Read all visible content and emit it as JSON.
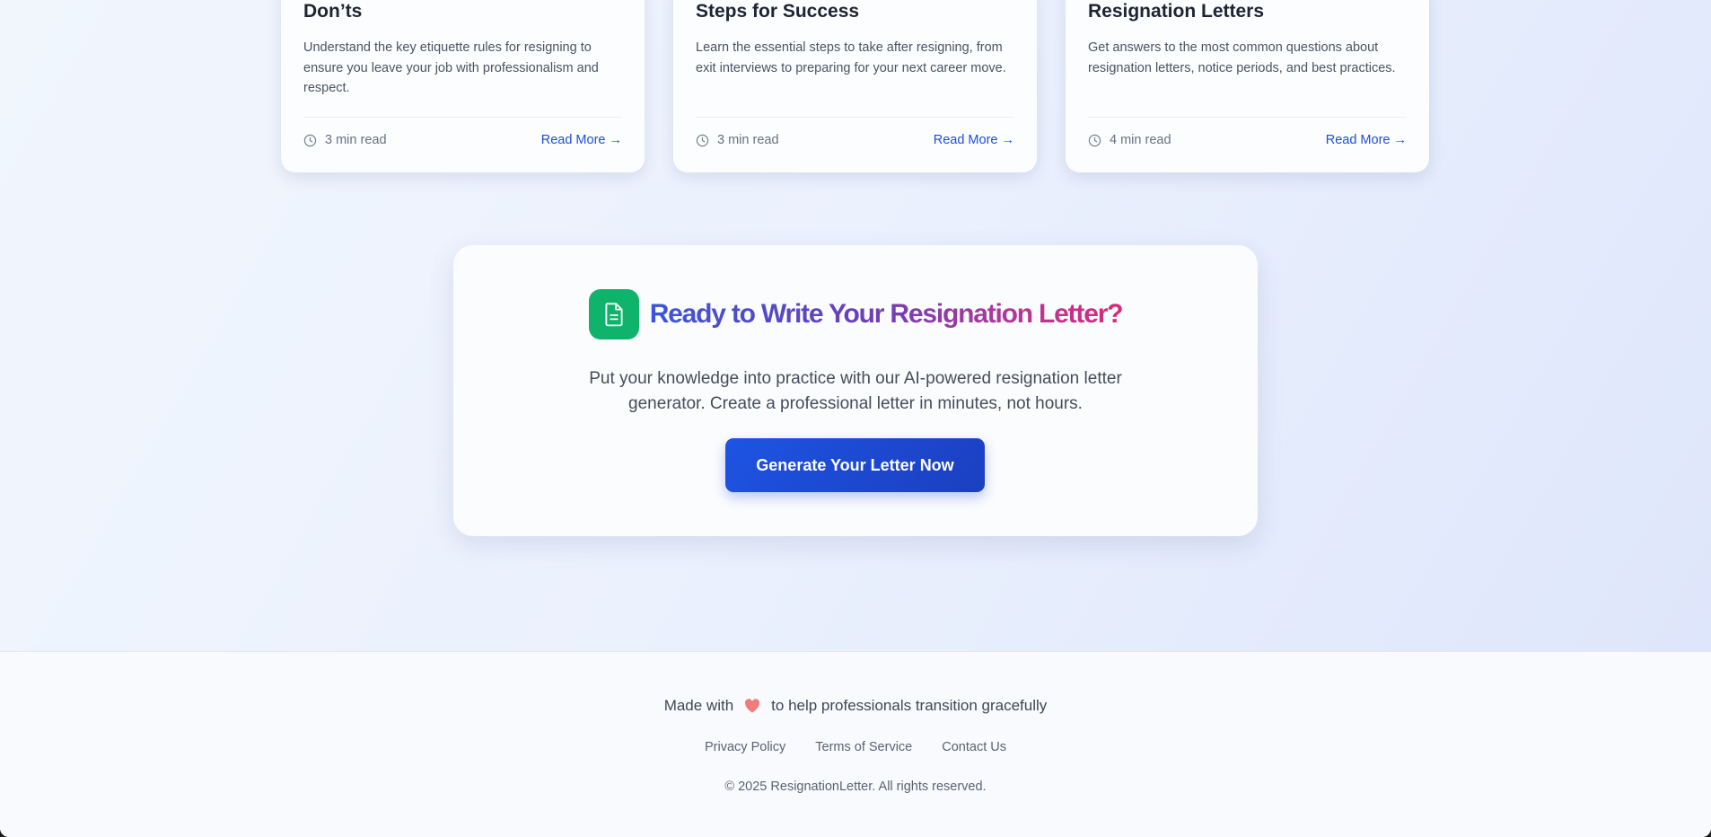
{
  "articles": [
    {
      "title": "Don’ts",
      "description": "Understand the key etiquette rules for resigning to ensure you leave your job with professionalism and respect.",
      "read_time": "3 min read",
      "link_label": "Read More →"
    },
    {
      "title": "Steps for Success",
      "description": "Learn the essential steps to take after resigning, from exit interviews to preparing for your next career move.",
      "read_time": "3 min read",
      "link_label": "Read More →"
    },
    {
      "title": "Resignation Letters",
      "description": "Get answers to the most common questions about resignation letters, notice periods, and best practices.",
      "read_time": "4 min read",
      "link_label": "Read More →"
    }
  ],
  "cta": {
    "title": "Ready to Write Your Resignation Letter?",
    "text_line1": "Put your knowledge into practice with our AI-powered resignation letter",
    "text_line2": "generator. Create a professional letter in minutes, not hours.",
    "button_label": "Generate Your Letter Now"
  },
  "footer": {
    "made_with_prefix": "Made with",
    "made_with_suffix": "to help professionals transition gracefully",
    "links": [
      "Privacy Policy",
      "Terms of Service",
      "Contact Us"
    ],
    "copyright": "© 2025 ResignationLetter. All rights reserved."
  },
  "colors": {
    "accent": "#1d4ed8",
    "icon_green": "#10b36b",
    "heart": "#ef7b7b"
  }
}
